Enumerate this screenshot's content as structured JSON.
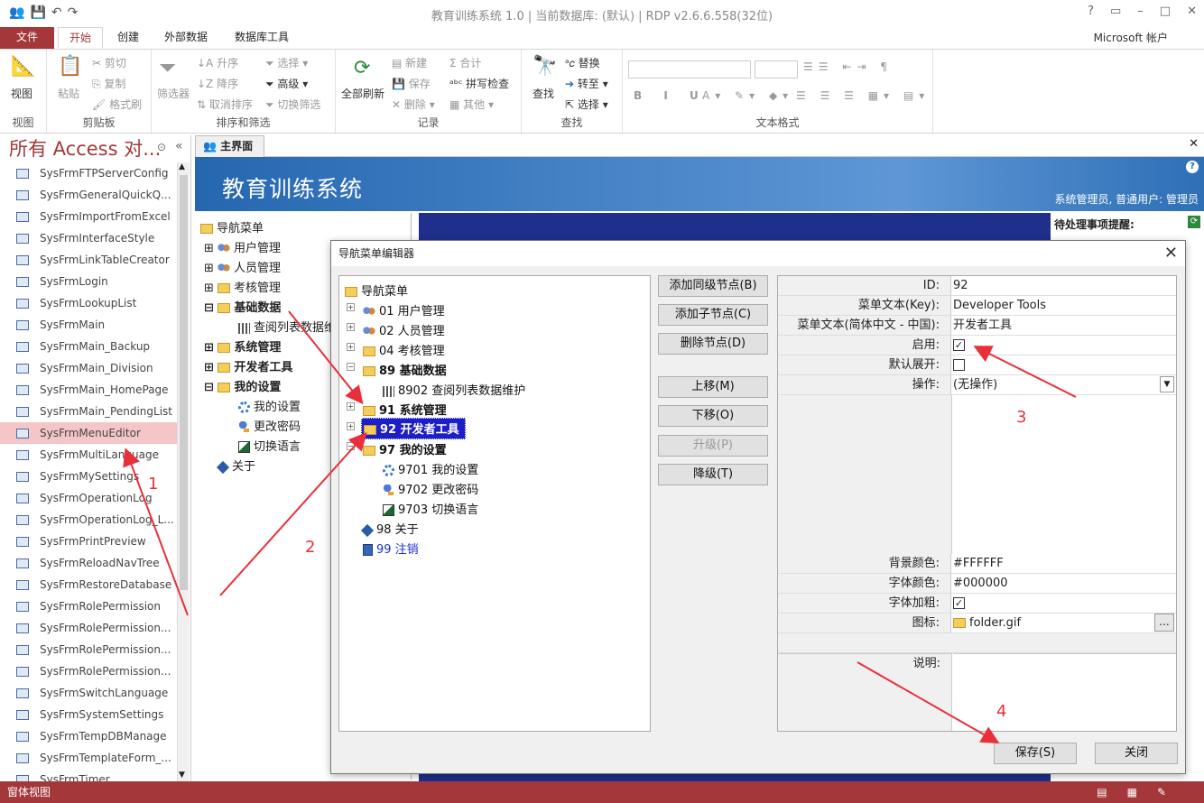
{
  "window": {
    "title": "教育训练系统 1.0 | 当前数据库: (默认) | RDP v2.6.6.558(32位)",
    "account": "Microsoft 帐户"
  },
  "menu_tabs": [
    "文件",
    "开始",
    "创建",
    "外部数据",
    "数据库工具"
  ],
  "ribbon": {
    "view": {
      "label": "视图",
      "group": "视图"
    },
    "clipboard": {
      "paste": "粘贴",
      "cut": "剪切",
      "copy": "复制",
      "format_painter": "格式刷",
      "group": "剪贴板"
    },
    "sort": {
      "filter": "筛选器",
      "asc": "升序",
      "desc": "降序",
      "remove_sort": "取消排序",
      "select": "选择",
      "advanced": "高级",
      "toggle_filter": "切换筛选",
      "group": "排序和筛选"
    },
    "records": {
      "refresh_all": "全部刷新",
      "new": "新建",
      "save": "保存",
      "delete": "删除",
      "totals": "合计",
      "spelling": "拼写检查",
      "more": "其他",
      "group": "记录"
    },
    "find": {
      "find": "查找",
      "replace": "替换",
      "goto": "转至",
      "select": "选择",
      "group": "查找"
    },
    "text": {
      "group": "文本格式"
    }
  },
  "nav_pane": {
    "title": "所有 Access 对...",
    "items": [
      "SysFrmFTPServerConfig",
      "SysFrmGeneralQuickQ...",
      "SysFrmImportFromExcel",
      "SysFrmInterfaceStyle",
      "SysFrmLinkTableCreator",
      "SysFrmLogin",
      "SysFrmLookupList",
      "SysFrmMain",
      "SysFrmMain_Backup",
      "SysFrmMain_Division",
      "SysFrmMain_HomePage",
      "SysFrmMain_PendingList",
      "SysFrmMenuEditor",
      "SysFrmMultiLanguage",
      "SysFrmMySettings",
      "SysFrmOperationLog",
      "SysFrmOperationLog_L...",
      "SysFrmPrintPreview",
      "SysFrmReloadNavTree",
      "SysFrmRestoreDatabase",
      "SysFrmRolePermission",
      "SysFrmRolePermission...",
      "SysFrmRolePermission...",
      "SysFrmRolePermission...",
      "SysFrmSwitchLanguage",
      "SysFrmSystemSettings",
      "SysFrmTempDBManage",
      "SysFrmTemplateForm_...",
      "SysFrmTimer"
    ]
  },
  "doc_tab": "主界面",
  "main_form": {
    "banner_title": "教育训练系统",
    "banner_info": "系统管理员, 普通用户: 管理员",
    "pending_title": "待处理事项提醒:",
    "tree": {
      "root": "导航菜单",
      "items": [
        "用户管理",
        "人员管理",
        "考核管理",
        "基础数据",
        "查阅列表数据维",
        "系统管理",
        "开发者工具",
        "我的设置",
        "我的设置",
        "更改密码",
        "切换语言",
        "关于"
      ]
    }
  },
  "dialog": {
    "title": "导航菜单编辑器",
    "tree": {
      "root": "导航菜单",
      "nodes": [
        "01 用户管理",
        "02 人员管理",
        "04 考核管理",
        "89 基础数据",
        "8902 查阅列表数据维护",
        "91 系统管理",
        "92 开发者工具",
        "97 我的设置",
        "9701 我的设置",
        "9702 更改密码",
        "9703 切换语言",
        "98 关于",
        "99 注销"
      ]
    },
    "buttons": {
      "add_sibling": "添加同级节点(B)",
      "add_child": "添加子节点(C)",
      "delete": "删除节点(D)",
      "move_up": "上移(M)",
      "move_down": "下移(O)",
      "promote": "升级(P)",
      "demote": "降级(T)",
      "save": "保存(S)",
      "close": "关闭"
    },
    "props": {
      "id_label": "ID:",
      "id": "92",
      "key_label": "菜单文本(Key):",
      "key": "Developer Tools",
      "zh_label": "菜单文本(简体中文 - 中国):",
      "zh": "开发者工具",
      "enabled_label": "启用:",
      "enabled": true,
      "expand_label": "默认展开:",
      "expand": false,
      "action_label": "操作:",
      "action": "(无操作)",
      "bg_label": "背景颜色:",
      "bg": "#FFFFFF",
      "fg_label": "字体颜色:",
      "fg": "#000000",
      "bold_label": "字体加粗:",
      "bold": true,
      "icon_label": "图标:",
      "icon": "folder.gif",
      "icon_btn": "...",
      "desc_label": "说明:"
    }
  },
  "annotations": [
    "1",
    "2",
    "3",
    "4"
  ],
  "status_bar": "窗体视图",
  "colors": {
    "accent": "#a4373a",
    "banner": "#2567b0",
    "selected_node": "#1c1fc9",
    "annotation": "#e8303a"
  }
}
